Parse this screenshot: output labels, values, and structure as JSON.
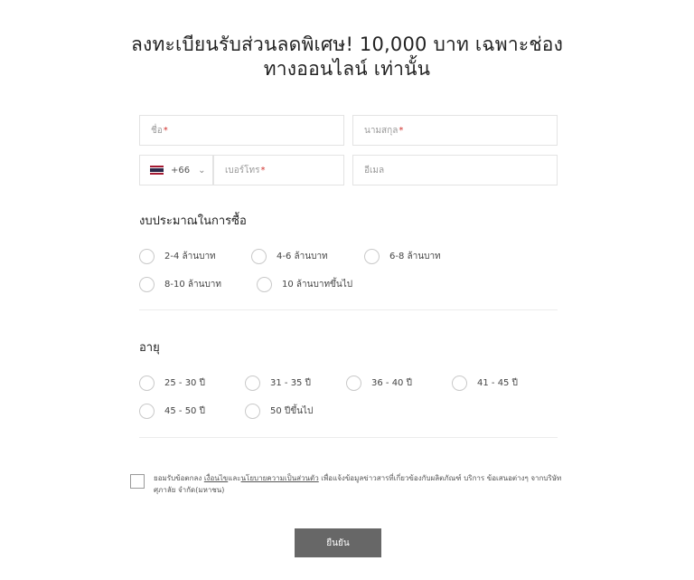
{
  "title_line1": "ลงทะเบียนรับส่วนลดพิเศษ! 10,000 บาท เฉพาะช่อง",
  "title_line2": "ทางออนไลน์ เท่านั้น",
  "fields": {
    "first_name_placeholder": "ชื่อ",
    "last_name_placeholder": "นามสกุล",
    "country_code": "+66",
    "phone_placeholder": "เบอร์โทร",
    "email_placeholder": "อีเมล",
    "required_mark": "*"
  },
  "budget": {
    "label": "งบประมาณในการซื้อ",
    "options": [
      "2-4 ล้านบาท",
      "4-6 ล้านบาท",
      "6-8 ล้านบาท",
      "8-10 ล้านบาท",
      "10 ล้านบาทขึ้นไป"
    ]
  },
  "age": {
    "label": "อายุ",
    "options": [
      "25 - 30 ปี",
      "31 - 35 ปี",
      "36 - 40 ปี",
      "41 - 45 ปี",
      "45 - 50 ปี",
      "50 ปีขึ้นไป"
    ]
  },
  "consent": {
    "prefix": "ยอมรับข้อตกลง ",
    "link_terms": "เงื่อนไข",
    "and": "และ",
    "link_privacy": "นโยบายความเป็นส่วนตัว",
    "suffix": " เพื่อแจ้งข้อมูลข่าวสารที่เกี่ยวข้องกับผลิตภัณฑ์ บริการ ข้อเสนอต่างๆ จากบริษัท ศุภาลัย จำกัด(มหาชน)"
  },
  "submit_label": "ยืนยัน",
  "colors": {
    "required": "#d0312d",
    "button_bg": "#676767",
    "flag_red": "#a51931",
    "flag_white": "#f4f5f8",
    "flag_blue": "#2d2a4a"
  }
}
